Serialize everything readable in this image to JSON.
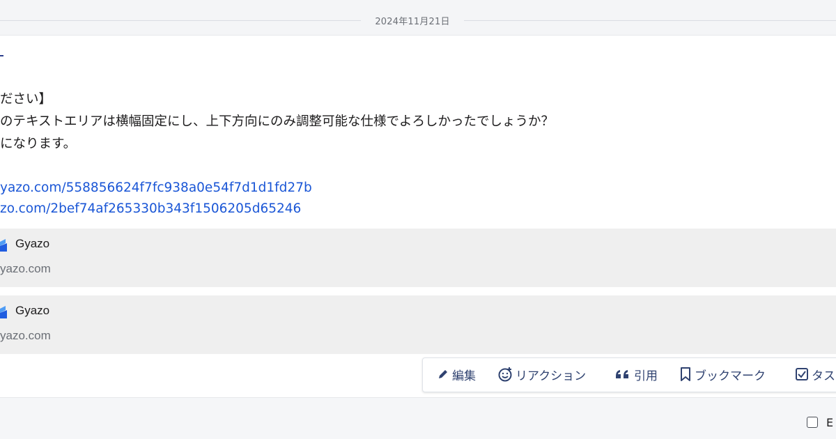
{
  "date_divider": {
    "label": "2024年11月21日"
  },
  "message": {
    "lines": [
      "ださい】",
      "のテキストエリアは横幅固定にし、上下方向にのみ調整可能な仕様でよろしかったでしょうか？",
      "になります。"
    ],
    "links": [
      "yazo.com/558856624f7fc938a0e54f7d1d1fd27b",
      "zo.com/2bef74af265330b343f1506205d65246"
    ]
  },
  "previews": [
    {
      "site_name": "Gyazo",
      "url": "yazo.com",
      "icon": "gyazo-icon"
    },
    {
      "site_name": "Gyazo",
      "url": "yazo.com",
      "icon": "gyazo-icon"
    }
  ],
  "actions": {
    "edit": "編集",
    "reaction": "リアクション",
    "quote": "引用",
    "bookmark": "ブックマーク",
    "task": "タス"
  },
  "footer": {
    "checkbox_label": "E"
  },
  "colors": {
    "link": "#1a56d6",
    "action_text": "#2f4270",
    "preview_bg": "#efefef"
  }
}
